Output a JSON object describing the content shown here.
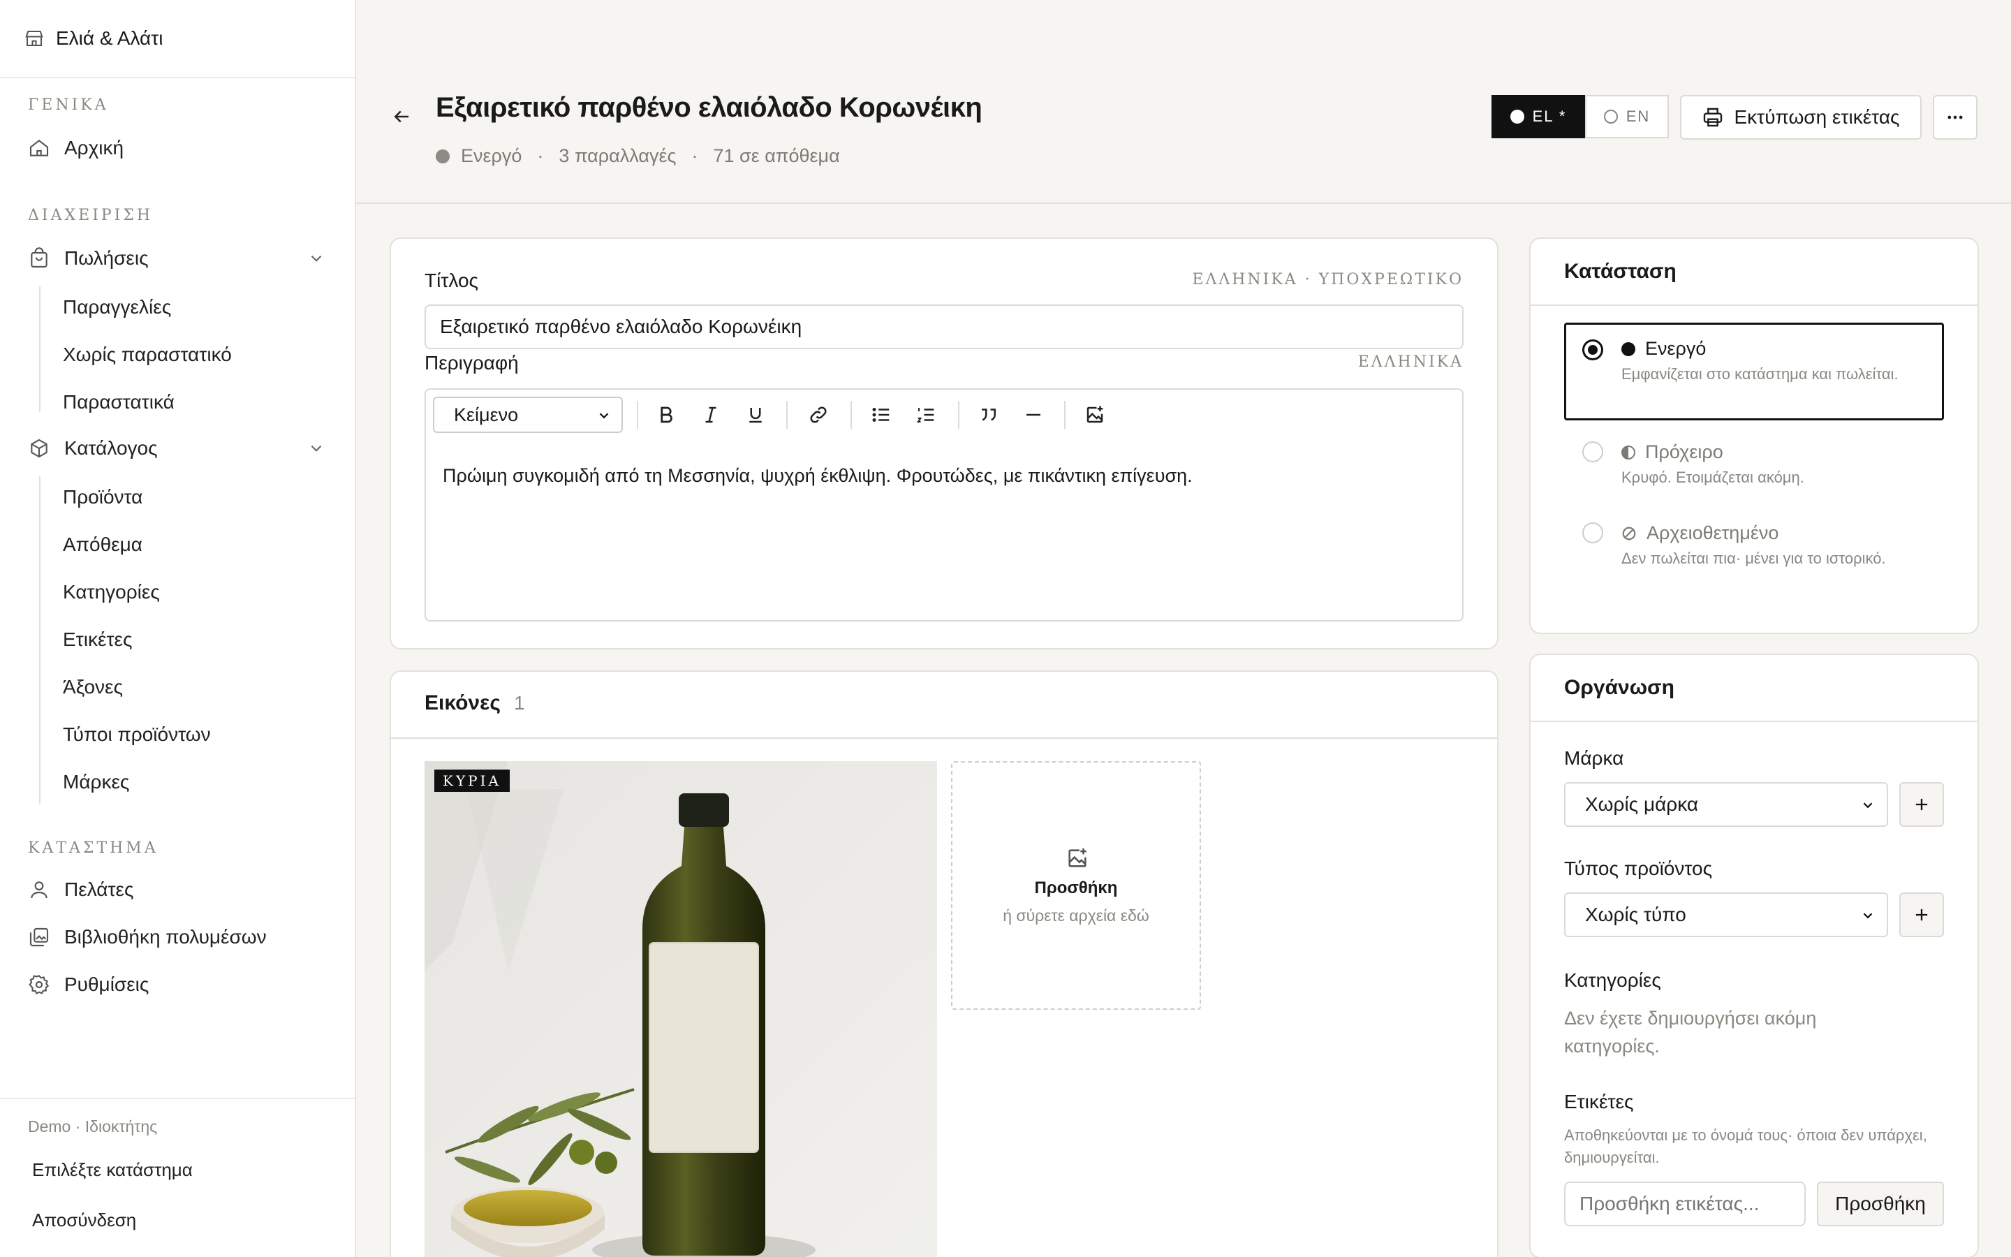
{
  "store": {
    "name": "Ελιά & Αλάτι"
  },
  "sidebar": {
    "section_general": "ΓΕΝΙΚΑ",
    "home": "Αρχική",
    "section_manage": "ΔΙΑΧΕΙΡΙΣΗ",
    "sales": "Πωλήσεις",
    "sales_items": [
      "Παραγγελίες",
      "Χωρίς παραστατικό",
      "Παραστατικά"
    ],
    "catalog": "Κατάλογος",
    "catalog_items": [
      "Προϊόντα",
      "Απόθεμα",
      "Κατηγορίες",
      "Ετικέτες",
      "Άξονες",
      "Τύποι προϊόντων",
      "Μάρκες"
    ],
    "section_store": "ΚΑΤΑΣΤΗΜΑ",
    "customers": "Πελάτες",
    "media": "Βιβλιοθήκη πολυμέσων",
    "settings": "Ρυθμίσεις",
    "role": "Demo · Ιδιοκτήτης",
    "choose_store": "Επιλέξτε κατάστημα",
    "logout": "Αποσύνδεση"
  },
  "header": {
    "title": "Εξαιρετικό παρθένο ελαιόλαδο Κορωνέικη",
    "status": "Ενεργό",
    "variants": "3 παραλλαγές",
    "stock": "71 σε απόθεμα",
    "lang_el": "EL *",
    "lang_en": "EN",
    "print_label": "Εκτύπωση ετικέτας"
  },
  "form": {
    "title_label": "Τίτλος",
    "title_hint": "ΕΛΛΗΝΙΚΑ · ΥΠΟΧΡΕΩΤΙΚΟ",
    "title_value": "Εξαιρετικό παρθένο ελαιόλαδο Κορωνέικη",
    "desc_label": "Περιγραφή",
    "desc_hint": "ΕΛΛΗΝΙΚΑ",
    "format_select": "Κείμενο",
    "desc_value": "Πρώιμη συγκομιδή από τη Μεσσηνία, ψυχρή έκθλιψη. Φρουτώδες, με πικάντικη επίγευση."
  },
  "images": {
    "title": "Εικόνες",
    "count": "1",
    "main_badge": "ΚΥΡΙΑ",
    "add": "Προσθήκη",
    "drop_hint": "ή σύρετε αρχεία εδώ"
  },
  "status_card": {
    "title": "Κατάσταση",
    "options": [
      {
        "label": "Ενεργό",
        "desc": "Εμφανίζεται στο κατάστημα και πωλείται.",
        "selected": true
      },
      {
        "label": "Πρόχειρο",
        "desc": "Κρυφό. Ετοιμάζεται ακόμη.",
        "selected": false
      },
      {
        "label": "Αρχειοθετημένο",
        "desc": "Δεν πωλείται πια· μένει για το ιστορικό.",
        "selected": false
      }
    ]
  },
  "organization": {
    "title": "Οργάνωση",
    "brand_label": "Μάρκα",
    "brand_value": "Χωρίς μάρκα",
    "type_label": "Τύπος προϊόντος",
    "type_value": "Χωρίς τύπο",
    "categories_label": "Κατηγορίες",
    "categories_empty": "Δεν έχετε δημιουργήσει ακόμη κατηγορίες.",
    "tags_label": "Ετικέτες",
    "tags_hint": "Αποθηκεύονται με το όνομά τους· όποια δεν υπάρχει, δημιουργείται.",
    "tags_placeholder": "Προσθήκη ετικέτας...",
    "tags_add": "Προσθήκη"
  }
}
